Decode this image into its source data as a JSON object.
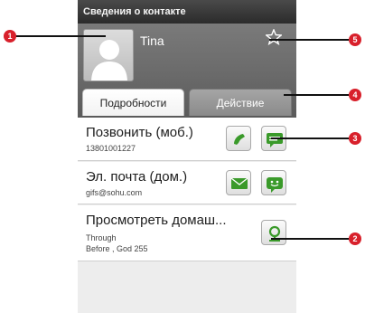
{
  "statusbar": {
    "title": "Сведения о контакте"
  },
  "contact": {
    "name": "Tina"
  },
  "tabs": [
    {
      "label": "Подробности",
      "active": true
    },
    {
      "label": "Действие",
      "active": false
    }
  ],
  "entries": {
    "call": {
      "title": "Позвонить (моб.)",
      "value": "13801001227"
    },
    "email": {
      "title": "Эл. почта (дом.)",
      "value": "gifs@sohu.com"
    },
    "map": {
      "title": "Просмотреть домаш...",
      "line1": "Through",
      "line2": "Before , God  255"
    }
  },
  "callouts": [
    "1",
    "2",
    "3",
    "4",
    "5"
  ],
  "colors": {
    "header": "#6a6a6a",
    "green_icon": "#3a9a2a",
    "callout": "#d8202b"
  },
  "icons": {
    "favorite": "star-icon",
    "call": "phone-icon",
    "sms": "message-icon",
    "email": "envelope-icon",
    "chat": "chat-icon",
    "map": "map-pin-icon",
    "avatar": "person-silhouette-icon"
  }
}
